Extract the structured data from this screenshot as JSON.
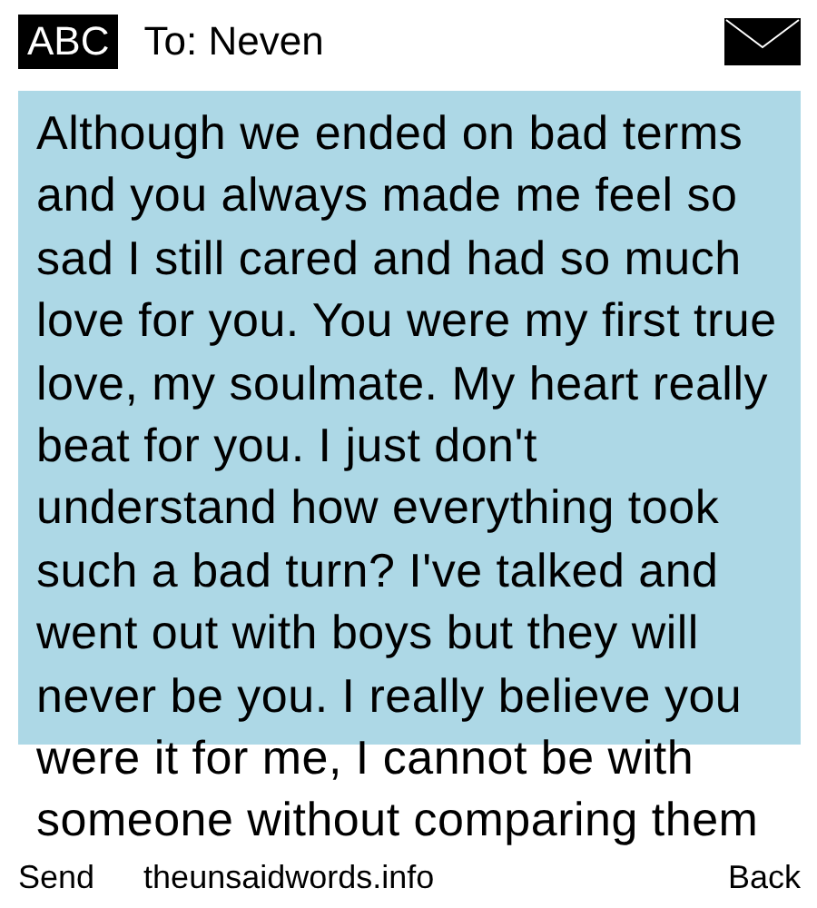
{
  "header": {
    "mode": "ABC",
    "recipient": "To: Neven"
  },
  "message": {
    "text": "Although we ended on bad terms and you always made me feel so sad I still cared and had so much love for you. You were my first true love, my soulmate. My heart really beat for you. I just don't understand how everything took such a bad turn? I've talked and went out with boys but they will never be you. I really believe you were it for me, I cannot be with someone without comparing them"
  },
  "softkeys": {
    "left": "Send",
    "center": "theunsaidwords.info",
    "right": "Back"
  }
}
